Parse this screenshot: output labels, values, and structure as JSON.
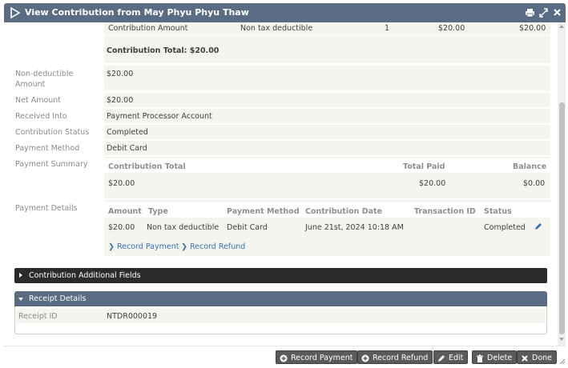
{
  "dialog": {
    "title": "View Contribution from May Phyu Phyu Thaw"
  },
  "line_item": {
    "label": "Contribution Amount",
    "type": "Non tax deductible",
    "qty": "1",
    "unit_price": "$20.00",
    "total": "$20.00"
  },
  "contribution_total": "Contribution Total: $20.00",
  "fields": {
    "non_deductible_label": "Non-deductible Amount",
    "non_deductible_value": "$20.00",
    "net_amount_label": "Net Amount",
    "net_amount_value": "$20.00",
    "received_into_label": "Received Into",
    "received_into_value": "Payment Processor Account",
    "status_label": "Contribution Status",
    "status_value": "Completed",
    "payment_method_label": "Payment Method",
    "payment_method_value": "Debit Card",
    "payment_summary_label": "Payment Summary",
    "payment_details_label": "Payment Details"
  },
  "summary": {
    "headers": [
      "Contribution Total",
      "Total Paid",
      "Balance"
    ],
    "values": [
      "$20.00",
      "$20.00",
      "$0.00"
    ]
  },
  "details": {
    "headers": [
      "Amount",
      "Type",
      "Payment Method",
      "Contribution Date",
      "Transaction ID",
      "Status"
    ],
    "row": [
      "$20.00",
      "Non tax deductible",
      "Debit Card",
      "June 21st, 2024 10:18 AM",
      "",
      "Completed"
    ]
  },
  "links": {
    "record_payment": "Record Payment",
    "record_refund": "Record Refund"
  },
  "panels": {
    "additional_fields": "Contribution Additional Fields",
    "receipt_details": "Receipt Details",
    "receipt_id_label": "Receipt ID",
    "receipt_id_value": "NTDR000019"
  },
  "buttons": {
    "record_payment": "Record Payment",
    "record_refund": "Record Refund",
    "edit": "Edit",
    "delete": "Delete",
    "done": "Done"
  },
  "colors": {
    "titlebar": "#5a6b84",
    "additional_bar": "#2b2b2b",
    "receipt_bar": "#5a6b84",
    "link": "#3b6fb5",
    "button": "#5b5b5b"
  }
}
